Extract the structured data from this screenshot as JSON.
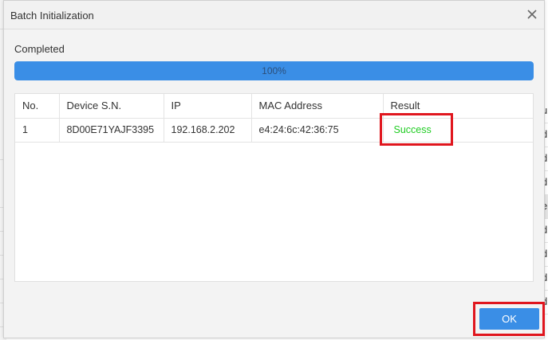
{
  "dialog": {
    "title": "Batch Initialization",
    "close_icon": "close-icon",
    "status_label": "Completed",
    "progress": {
      "percent": 100,
      "text": "100%"
    },
    "ok_label": "OK"
  },
  "table": {
    "headers": {
      "no": "No.",
      "sn": "Device S.N.",
      "ip": "IP",
      "mac": "MAC Address",
      "result": "Result"
    },
    "rows": [
      {
        "no": "1",
        "sn": "8D00E71YAJF3395",
        "ip": "192.168.2.202",
        "mac": "e4:24:6c:42:36:75",
        "result": "Success"
      }
    ]
  },
  "background": {
    "right_fragments": [
      "u",
      "d",
      "d",
      "d",
      "e",
      "d",
      "d",
      "d",
      "d"
    ]
  },
  "colors": {
    "accent": "#3a8ee6",
    "success": "#1fcc22",
    "highlight": "#e0161e"
  }
}
